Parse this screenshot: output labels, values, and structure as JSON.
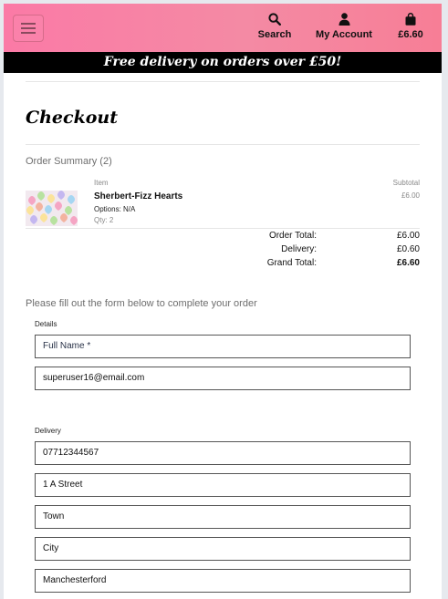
{
  "header": {
    "nav": {
      "search_label": "Search",
      "account_label": "My Account",
      "bag_total": "£6.60"
    }
  },
  "promo": {
    "text": "Free delivery on orders over £50!"
  },
  "checkout": {
    "title": "Checkout",
    "summary_label": "Order Summary (2)",
    "columns": {
      "item": "Item",
      "subtotal": "Subtotal"
    },
    "items": [
      {
        "name": "Sherbert-Fizz Hearts",
        "options": "Options: N/A",
        "qty": "Qty: 2",
        "subtotal": "£6.00"
      }
    ],
    "totals": {
      "order_total_label": "Order Total:",
      "order_total": "£6.00",
      "delivery_label": "Delivery:",
      "delivery": "£0.60",
      "grand_total_label": "Grand Total:",
      "grand_total": "£6.60"
    }
  },
  "form": {
    "intro": "Please fill out the form below to complete your order",
    "details_legend": "Details",
    "full_name_placeholder": "Full Name *",
    "email_value": "superuser16@email.com",
    "delivery_legend": "Delivery",
    "phone_value": "07712344567",
    "street_value": "1 A Street",
    "town_value": "Town",
    "city_value": "City",
    "county_value": "Manchesterford"
  },
  "colors": {
    "header_gradient_start": "#fb7aa6",
    "header_gradient_end": "#f77e96",
    "promo_bar": "#000000"
  }
}
